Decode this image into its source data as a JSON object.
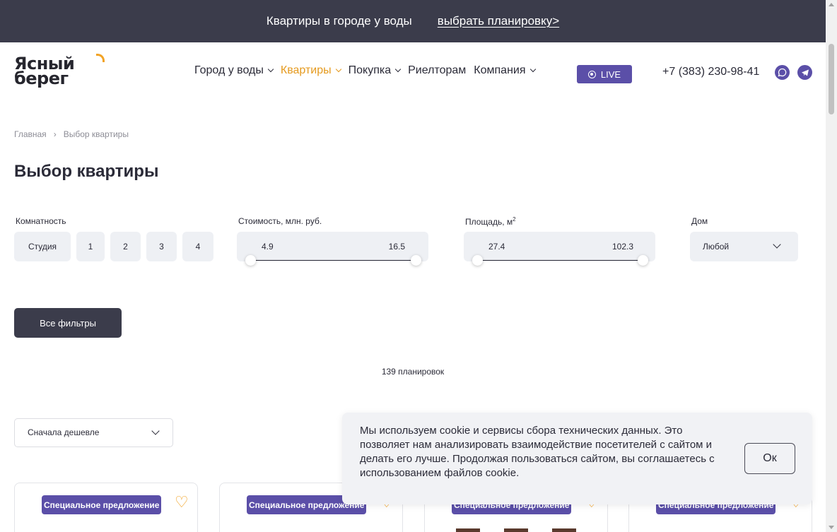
{
  "promo_bar": {
    "text": "Квартиры в городе у воды",
    "link": "выбрать планировку>"
  },
  "header": {
    "logo_line1": "Ясный",
    "logo_line2": "берег",
    "nav": [
      {
        "label": "Город у воды",
        "has_dropdown": true,
        "active": false
      },
      {
        "label": "Квартиры",
        "has_dropdown": true,
        "active": true
      },
      {
        "label": "Покупка",
        "has_dropdown": true,
        "active": false
      },
      {
        "label": "Риелторам",
        "has_dropdown": false,
        "active": false
      },
      {
        "label": "Компания",
        "has_dropdown": true,
        "active": false
      }
    ],
    "live_label": "LIVE",
    "phone": "+7 (383) 230-98-41",
    "social": [
      "whatsapp-icon",
      "telegram-icon"
    ]
  },
  "breadcrumb": {
    "home": "Главная",
    "current": "Выбор квартиры"
  },
  "page_title": "Выбор квартиры",
  "filters": {
    "rooms_label": "Комнатность",
    "rooms": [
      "Студия",
      "1",
      "2",
      "3",
      "4"
    ],
    "price_label": "Стоимость, млн. руб.",
    "price_min": "4.9",
    "price_max": "16.5",
    "area_label": "Площадь, м",
    "area_unit_sup": "2",
    "area_min": "27.4",
    "area_max": "102.3",
    "house_label": "Дом",
    "house_value": "Любой",
    "all_filters_label": "Все фильтры"
  },
  "results_count": "139 планировок",
  "sort": {
    "value": "Сначала дешевле"
  },
  "cards": [
    {
      "badge": "Специальное предложение"
    },
    {
      "badge": "Специальное предложение"
    },
    {
      "badge": "Специальное предложение"
    },
    {
      "badge": "Специальное предложение"
    }
  ],
  "cookie": {
    "text": "Мы используем cookie и сервисы сбора технических данных. Это позволяет нам анализировать взаимодействие посетителей с сайтом и делать его лучше. Продолжая пользоваться сайтом, вы соглашаетесь с использованием файлов cookie.",
    "ok_label": "Ок"
  },
  "colors": {
    "dark": "#3b3c4b",
    "accent_purple": "#5b4fa8",
    "accent_orange": "#f2a325",
    "filter_bg": "#eef0f4"
  }
}
